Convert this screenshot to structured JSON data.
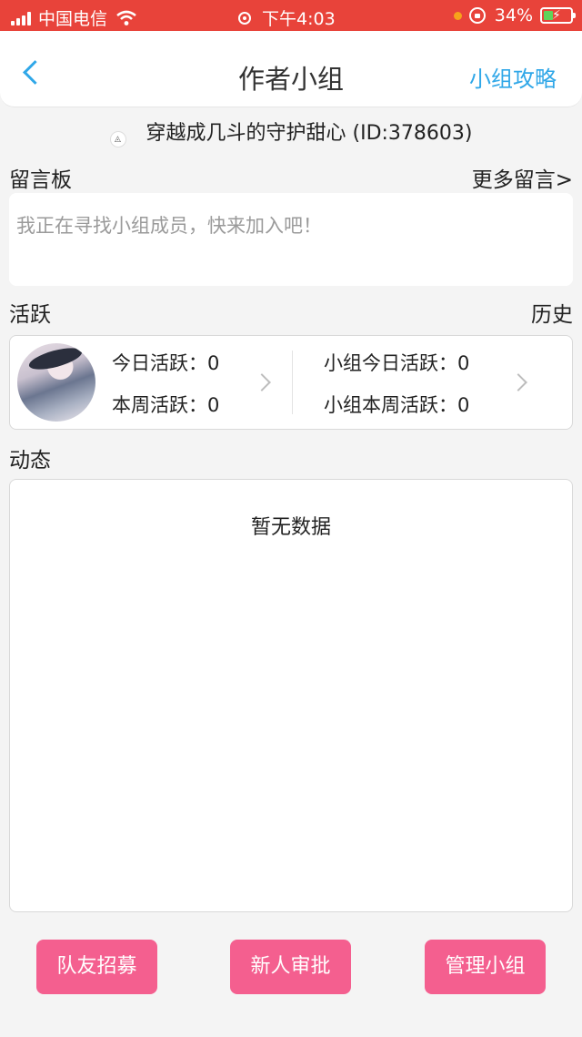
{
  "status_bar": {
    "carrier": "中国电信",
    "time": "下午4:03",
    "battery": "34%",
    "battery_level": 0.34
  },
  "navbar": {
    "title": "作者小组",
    "right_link": "小组攻略",
    "back_icon": "chevron-left-icon"
  },
  "group": {
    "name_line": "穿越成几斗的守护甜心 (ID:378603)"
  },
  "message_board": {
    "label": "留言板",
    "more_link": "更多留言>",
    "placeholder": "我正在寻找小组成员，快来加入吧！"
  },
  "activity": {
    "label": "活跃",
    "history_link": "历史",
    "today": "今日活跃：0",
    "week": "本周活跃：0",
    "group_today": "小组今日活跃：0",
    "group_week": "小组本周活跃：0"
  },
  "feed": {
    "label": "动态",
    "empty_text": "暂无数据"
  },
  "buttons": {
    "recruit": "队友招募",
    "approve": "新人审批",
    "manage": "管理小组"
  },
  "colors": {
    "status_bar": "#e8433a",
    "accent_link": "#2fa7e8",
    "button": "#f45f8f"
  }
}
